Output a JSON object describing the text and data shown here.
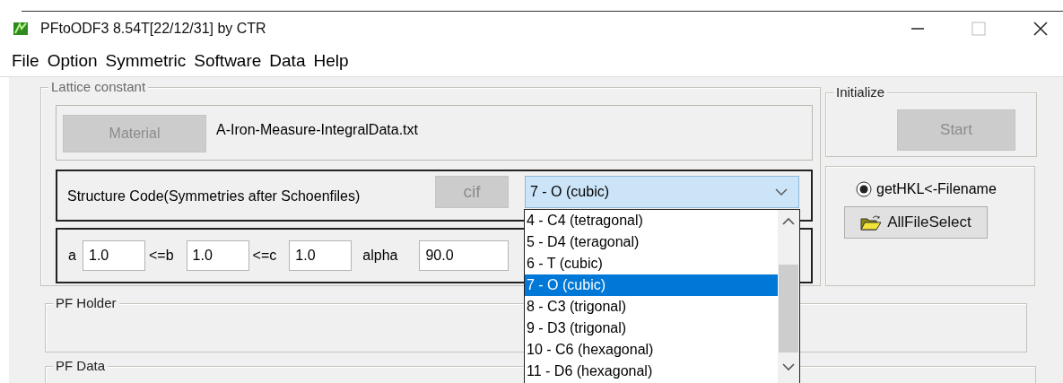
{
  "window": {
    "title": "PFtoODF3 8.54T[22/12/31] by CTR"
  },
  "menu": [
    "File",
    "Option",
    "Symmetric",
    "Software",
    "Data",
    "Help"
  ],
  "lattice": {
    "label": "Lattice constant",
    "material_button": {
      "label": "Material",
      "disabled": true
    },
    "filename": "A-Iron-Measure-IntegralData.txt",
    "structure_label": "Structure Code(Symmetries after Schoenfiles)",
    "cif_button": {
      "label": "cif",
      "disabled": true
    },
    "structure_combo": {
      "value": "7 - O (cubic)",
      "expanded": true,
      "options": [
        {
          "label": "4 - C4 (tetragonal)",
          "selected": false
        },
        {
          "label": "5 - D4 (teragonal)",
          "selected": false
        },
        {
          "label": "6 - T (cubic)",
          "selected": false
        },
        {
          "label": "7 - O (cubic)",
          "selected": true
        },
        {
          "label": "8 - C3 (trigonal)",
          "selected": false
        },
        {
          "label": "9 - D3 (trigonal)",
          "selected": false
        },
        {
          "label": "10 - C6 (hexagonal)",
          "selected": false
        },
        {
          "label": "11 - D6 (hexagonal)",
          "selected": false
        }
      ]
    },
    "params": [
      {
        "label": "a",
        "value": "1.0"
      },
      {
        "label": "<=b",
        "value": "1.0"
      },
      {
        "label": "<=c",
        "value": "1.0"
      },
      {
        "label": "alpha",
        "value": "90.0"
      }
    ]
  },
  "initialize": {
    "label": "Initialize",
    "start_button": {
      "label": "Start",
      "disabled": true
    }
  },
  "hkl": {
    "radio": {
      "label": "getHKL<-Filename",
      "checked": true
    },
    "button": "AllFileSelect"
  },
  "pf_holder": {
    "label": "PF Holder"
  },
  "pf_data": {
    "label": "PF Data"
  }
}
